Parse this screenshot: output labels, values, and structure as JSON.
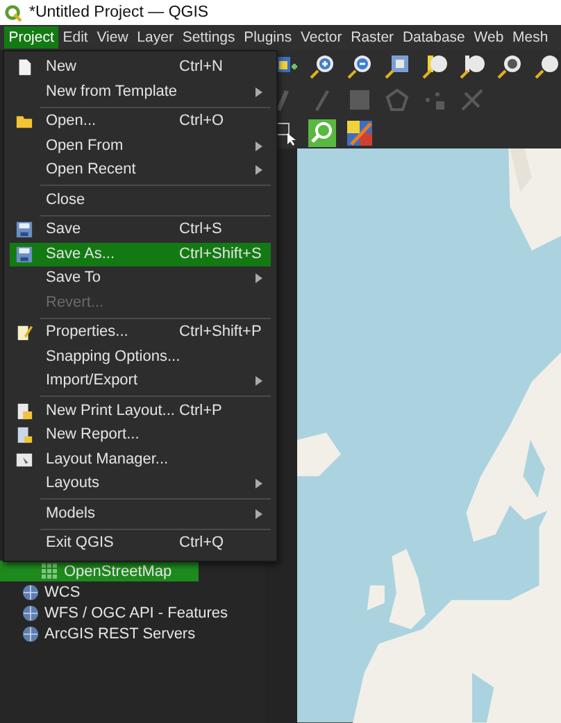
{
  "window": {
    "title": "*Untitled Project — QGIS"
  },
  "menubar": {
    "items": [
      {
        "label": "Project",
        "selected": true
      },
      {
        "label": "Edit",
        "selected": false
      },
      {
        "label": "View",
        "selected": false
      },
      {
        "label": "Layer",
        "selected": false
      },
      {
        "label": "Settings",
        "selected": false
      },
      {
        "label": "Plugins",
        "selected": false
      },
      {
        "label": "Vector",
        "selected": false
      },
      {
        "label": "Raster",
        "selected": false
      },
      {
        "label": "Database",
        "selected": false
      },
      {
        "label": "Web",
        "selected": false
      },
      {
        "label": "Mesh",
        "selected": false
      }
    ]
  },
  "project_menu": {
    "items": [
      {
        "kind": "item",
        "label": "New",
        "shortcut": "Ctrl+N",
        "submenu": false,
        "selected": false,
        "disabled": false
      },
      {
        "kind": "item",
        "label": "New from Template",
        "submenu": true,
        "selected": false,
        "disabled": false
      },
      {
        "kind": "separator"
      },
      {
        "kind": "item",
        "label": "Open...",
        "shortcut": "Ctrl+O",
        "submenu": false,
        "selected": false,
        "disabled": false
      },
      {
        "kind": "item",
        "label": "Open From",
        "submenu": true,
        "selected": false,
        "disabled": false
      },
      {
        "kind": "item",
        "label": "Open Recent",
        "submenu": true,
        "selected": false,
        "disabled": false
      },
      {
        "kind": "separator"
      },
      {
        "kind": "item",
        "label": "Close",
        "submenu": false,
        "selected": false,
        "disabled": false
      },
      {
        "kind": "separator"
      },
      {
        "kind": "item",
        "label": "Save",
        "shortcut": "Ctrl+S",
        "submenu": false,
        "selected": false,
        "disabled": false
      },
      {
        "kind": "item",
        "label": "Save As...",
        "shortcut": "Ctrl+Shift+S",
        "submenu": false,
        "selected": true,
        "disabled": false
      },
      {
        "kind": "item",
        "label": "Save To",
        "submenu": true,
        "selected": false,
        "disabled": false
      },
      {
        "kind": "item",
        "label": "Revert...",
        "submenu": false,
        "selected": false,
        "disabled": true
      },
      {
        "kind": "separator"
      },
      {
        "kind": "item",
        "label": "Properties...",
        "shortcut": "Ctrl+Shift+P",
        "submenu": false,
        "selected": false,
        "disabled": false
      },
      {
        "kind": "item",
        "label": "Snapping Options...",
        "submenu": false,
        "selected": false,
        "disabled": false
      },
      {
        "kind": "item",
        "label": "Import/Export",
        "submenu": true,
        "selected": false,
        "disabled": false
      },
      {
        "kind": "separator"
      },
      {
        "kind": "item",
        "label": "New Print Layout...",
        "shortcut": "Ctrl+P",
        "submenu": false,
        "selected": false,
        "disabled": false
      },
      {
        "kind": "item",
        "label": "New Report...",
        "submenu": false,
        "selected": false,
        "disabled": false
      },
      {
        "kind": "item",
        "label": "Layout Manager...",
        "submenu": false,
        "selected": false,
        "disabled": false
      },
      {
        "kind": "item",
        "label": "Layouts",
        "submenu": true,
        "selected": false,
        "disabled": false
      },
      {
        "kind": "separator"
      },
      {
        "kind": "item",
        "label": "Models",
        "submenu": true,
        "selected": false,
        "disabled": false
      },
      {
        "kind": "separator"
      },
      {
        "kind": "item",
        "label": "Exit QGIS",
        "shortcut": "Ctrl+Q",
        "submenu": false,
        "selected": false,
        "disabled": false
      }
    ]
  },
  "browser": {
    "items": [
      {
        "kind": "tile-layer",
        "label": "OpenStreetMap",
        "selected": true
      },
      {
        "kind": "service",
        "label": "WCS",
        "selected": false
      },
      {
        "kind": "service",
        "label": "WFS / OGC API - Features",
        "selected": false
      },
      {
        "kind": "service",
        "label": "ArcGIS REST Servers",
        "selected": false
      }
    ]
  }
}
